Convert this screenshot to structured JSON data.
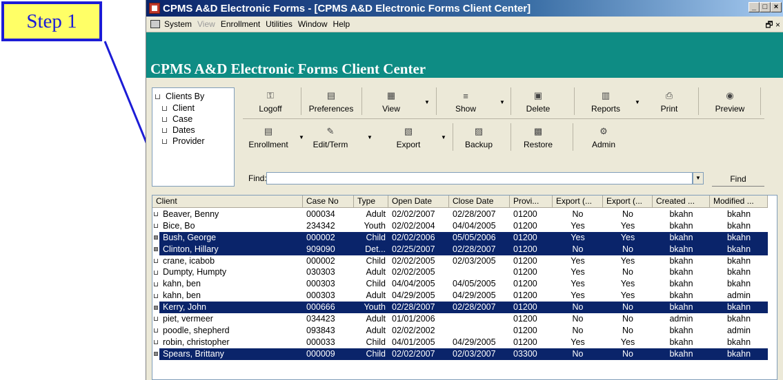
{
  "step_label": "Step 1",
  "window": {
    "title": "CPMS A&D Electronic Forms - [CPMS A&D  Electronic Forms Client Center]",
    "buttons": [
      "_",
      "□",
      "×"
    ]
  },
  "menu": {
    "items": [
      {
        "label": "System",
        "enabled": true
      },
      {
        "label": "View",
        "enabled": false
      },
      {
        "label": "Enrollment",
        "enabled": true
      },
      {
        "label": "Utilities",
        "enabled": true
      },
      {
        "label": "Window",
        "enabled": true
      },
      {
        "label": "Help",
        "enabled": true
      }
    ],
    "mdi_controls": "🗗 ×"
  },
  "banner": {
    "title": "CPMS A&D Electronic Forms Client Center"
  },
  "tree": {
    "items": [
      "Clients By",
      "Client",
      "Case",
      "Dates",
      "Provider"
    ]
  },
  "toolbar": {
    "row1": [
      {
        "label": "Logoff",
        "icon": "key-icon"
      },
      {
        "label": "Preferences",
        "icon": "preferences-icon"
      },
      {
        "label": "View",
        "icon": "view-icon"
      },
      {
        "label": "Show",
        "icon": "show-icon"
      },
      {
        "label": "Delete",
        "icon": "delete-icon"
      },
      {
        "label": "Reports",
        "icon": "reports-icon"
      },
      {
        "label": "Print",
        "icon": "printer-icon"
      },
      {
        "label": "Preview",
        "icon": "preview-icon"
      }
    ],
    "row2": [
      {
        "label": "Enrollment",
        "icon": "enrollment-icon"
      },
      {
        "label": "Edit/Term",
        "icon": "edit-icon"
      },
      {
        "label": "Export",
        "icon": "export-icon"
      },
      {
        "label": "Backup",
        "icon": "backup-icon"
      },
      {
        "label": "Restore",
        "icon": "restore-icon"
      },
      {
        "label": "Admin",
        "icon": "admin-icon"
      }
    ]
  },
  "find": {
    "label": "Find:",
    "value": "",
    "button": "Find"
  },
  "grid": {
    "columns": [
      "Client",
      "Case No",
      "Type",
      "Open Date",
      "Close Date",
      "Provi...",
      "Export (...",
      "Export (...",
      "Created ...",
      "Modified ..."
    ],
    "rows": [
      {
        "client": "Beaver, Benny",
        "case": "000034",
        "type": "Adult",
        "open": "02/02/2007",
        "close": "02/28/2007",
        "prov": "01200",
        "exp1": "No",
        "exp2": "No",
        "created": "bkahn",
        "modified": "bkahn",
        "selected": false
      },
      {
        "client": "Bice, Bo",
        "case": "234342",
        "type": "Youth",
        "open": "02/02/2004",
        "close": "04/04/2005",
        "prov": "01200",
        "exp1": "Yes",
        "exp2": "Yes",
        "created": "bkahn",
        "modified": "bkahn",
        "selected": false
      },
      {
        "client": "Bush, George",
        "case": "000002",
        "type": "Child",
        "open": "02/02/2006",
        "close": "05/05/2006",
        "prov": "01200",
        "exp1": "Yes",
        "exp2": "Yes",
        "created": "bkahn",
        "modified": "bkahn",
        "selected": true
      },
      {
        "client": "Clinton, Hillary",
        "case": "909090",
        "type": "Det...",
        "open": "02/25/2007",
        "close": "02/28/2007",
        "prov": "01200",
        "exp1": "No",
        "exp2": "No",
        "created": "bkahn",
        "modified": "bkahn",
        "selected": true
      },
      {
        "client": "crane, icabob",
        "case": "000002",
        "type": "Child",
        "open": "02/02/2005",
        "close": "02/03/2005",
        "prov": "01200",
        "exp1": "Yes",
        "exp2": "Yes",
        "created": "bkahn",
        "modified": "bkahn",
        "selected": false
      },
      {
        "client": "Dumpty, Humpty",
        "case": "030303",
        "type": "Adult",
        "open": "02/02/2005",
        "close": "",
        "prov": "01200",
        "exp1": "Yes",
        "exp2": "No",
        "created": "bkahn",
        "modified": "bkahn",
        "selected": false
      },
      {
        "client": "kahn, ben",
        "case": "000303",
        "type": "Child",
        "open": "04/04/2005",
        "close": "04/05/2005",
        "prov": "01200",
        "exp1": "Yes",
        "exp2": "Yes",
        "created": "bkahn",
        "modified": "bkahn",
        "selected": false
      },
      {
        "client": "kahn, ben",
        "case": "000303",
        "type": "Adult",
        "open": "04/29/2005",
        "close": "04/29/2005",
        "prov": "01200",
        "exp1": "Yes",
        "exp2": "Yes",
        "created": "bkahn",
        "modified": "admin",
        "selected": false
      },
      {
        "client": "Kerry, John",
        "case": "000666",
        "type": "Youth",
        "open": "02/28/2007",
        "close": "02/28/2007",
        "prov": "01200",
        "exp1": "No",
        "exp2": "No",
        "created": "bkahn",
        "modified": "bkahn",
        "selected": true
      },
      {
        "client": "piet, vermeer",
        "case": "034423",
        "type": "Adult",
        "open": "01/01/2006",
        "close": "",
        "prov": "01200",
        "exp1": "No",
        "exp2": "No",
        "created": "admin",
        "modified": "bkahn",
        "selected": false
      },
      {
        "client": "poodle, shepherd",
        "case": "093843",
        "type": "Adult",
        "open": "02/02/2002",
        "close": "",
        "prov": "01200",
        "exp1": "No",
        "exp2": "No",
        "created": "bkahn",
        "modified": "admin",
        "selected": false
      },
      {
        "client": "robin, christopher",
        "case": "000033",
        "type": "Child",
        "open": "04/01/2005",
        "close": "04/29/2005",
        "prov": "01200",
        "exp1": "Yes",
        "exp2": "Yes",
        "created": "bkahn",
        "modified": "bkahn",
        "selected": false
      },
      {
        "client": "Spears, Brittany",
        "case": "000009",
        "type": "Child",
        "open": "02/02/2007",
        "close": "02/03/2007",
        "prov": "03300",
        "exp1": "No",
        "exp2": "No",
        "created": "bkahn",
        "modified": "bkahn",
        "selected": true
      }
    ]
  },
  "colors": {
    "selection": "#0a246a",
    "banner": "#0e8c84",
    "callout_border": "#1c1cd6",
    "callout_fill": "#ffff66"
  }
}
